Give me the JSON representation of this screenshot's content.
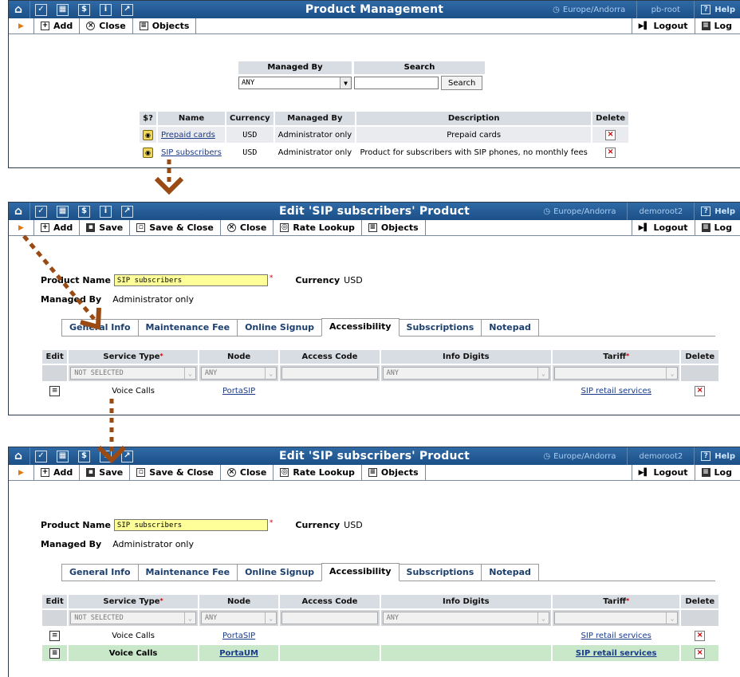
{
  "common": {
    "timezone": "Europe/Andorra",
    "help_label": "Help",
    "help_glyph": "?",
    "logout_label": "Logout",
    "log_label": "Log"
  },
  "panel1": {
    "title": "Product Management",
    "user": "pb-root",
    "toolbar": {
      "add": "Add",
      "close": "Close",
      "objects": "Objects"
    },
    "search": {
      "managed_by_header": "Managed By",
      "search_header": "Search",
      "managed_by_value": "ANY",
      "search_value": "",
      "search_button": "Search"
    },
    "table": {
      "headers": [
        "$?",
        "Name",
        "Currency",
        "Managed By",
        "Description",
        "Delete"
      ],
      "rows": [
        {
          "name": "Prepaid cards",
          "currency": "USD",
          "managed_by": "Administrator only",
          "description": "Prepaid cards"
        },
        {
          "name": "SIP subscribers",
          "currency": "USD",
          "managed_by": "Administrator only",
          "description": "Product for subscribers with SIP phones, no monthly fees"
        }
      ]
    }
  },
  "edit": {
    "title": "Edit 'SIP subscribers' Product",
    "user": "demoroot2",
    "toolbar": {
      "add": "Add",
      "save": "Save",
      "save_close": "Save & Close",
      "close": "Close",
      "rate_lookup": "Rate Lookup",
      "objects": "Objects"
    },
    "product_name_label": "Product Name",
    "product_name_value": "SIP subscribers",
    "currency_label": "Currency",
    "currency_value": "USD",
    "managed_by_label": "Managed By",
    "managed_by_value": "Administrator only",
    "tabs": [
      "General Info",
      "Maintenance Fee",
      "Online Signup",
      "Accessibility",
      "Subscriptions",
      "Notepad"
    ],
    "active_tab": "Accessibility",
    "acc_headers": [
      "Edit",
      "Service Type",
      "Node",
      "Access Code",
      "Info Digits",
      "Tariff",
      "Delete"
    ],
    "filter": {
      "service_type": "NOT SELECTED",
      "node": "ANY",
      "access_code": "",
      "info_digits": "ANY",
      "tariff": ""
    },
    "rows": [
      {
        "service_type": "Voice Calls",
        "node": "PortaSIP",
        "access_code": "",
        "info_digits": "",
        "tariff": "SIP retail services"
      },
      {
        "service_type": "Voice Calls",
        "node": "PortaUM",
        "access_code": "",
        "info_digits": "",
        "tariff": "SIP retail services"
      }
    ]
  },
  "colors": {
    "titlebar": "#1c4f86",
    "arrow": "#9a4a12",
    "new_row": "#c9e8c9",
    "required": "#cc0000"
  }
}
